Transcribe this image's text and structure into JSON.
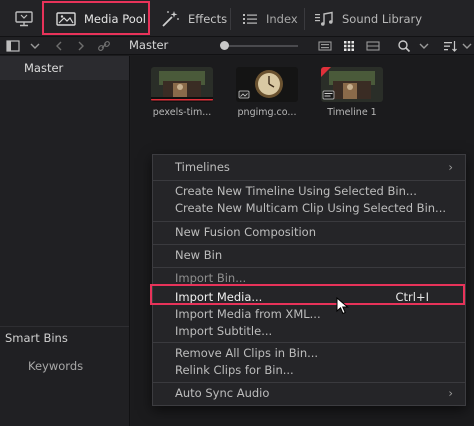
{
  "toolbar": {
    "media_pool": "Media Pool",
    "effects": "Effects",
    "index": "Index",
    "sound_library": "Sound Library"
  },
  "subbar": {
    "title": "Master"
  },
  "bins": {
    "master": "Master",
    "smart_bins": "Smart Bins",
    "keywords": "Keywords"
  },
  "clips": [
    {
      "label": "pexels-tim...",
      "kind": "video"
    },
    {
      "label": "pngimg.co...",
      "kind": "image"
    },
    {
      "label": "Timeline 1",
      "kind": "timeline"
    }
  ],
  "context_menu": {
    "items": [
      {
        "label": "Timelines",
        "submenu": true
      },
      {
        "label": "Create New Timeline Using Selected Bin..."
      },
      {
        "label": "Create New Multicam Clip Using Selected Bin..."
      },
      {
        "label": "New Fusion Composition"
      },
      {
        "label": "New Bin"
      },
      {
        "label": "Import Bin..."
      },
      {
        "label": "Import Media...",
        "shortcut": "Ctrl+I",
        "highlighted": true
      },
      {
        "label": "Import Media from XML..."
      },
      {
        "label": "Import Subtitle..."
      },
      {
        "label": "Remove All Clips in Bin..."
      },
      {
        "label": "Relink Clips for Bin..."
      },
      {
        "label": "Auto Sync Audio",
        "submenu": true
      }
    ]
  },
  "colors": {
    "highlight": "#e8335a",
    "accent_red": "#e0303a"
  }
}
